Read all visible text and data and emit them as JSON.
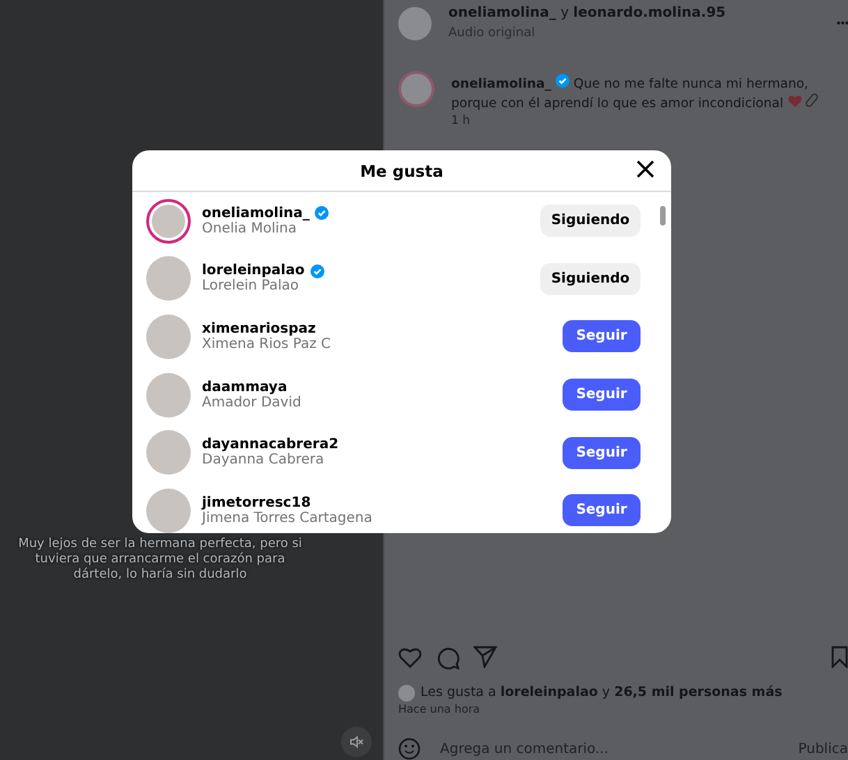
{
  "video": {
    "subtitle": "Muy lejos de ser la hermana perfecta, pero si tuviera que arrancarme el corazón para dártelo, lo haría sin dudarlo",
    "muted": true
  },
  "post": {
    "authors": "**oneliamolina_** y **leonardo.molina.95**",
    "audio": "Audio original",
    "caption": {
      "user": "oneliamolina_",
      "verified": true,
      "text": "Que no me falte nunca mi hermano, porque con él aprendí lo que es amor incondicional",
      "time": "1 h"
    },
    "likes": "Les gusta a **loreleinpalao** y **26,5 mil personas más**",
    "posted": "Hace una hora",
    "comment": {
      "placeholder": "Agrega un comentario...",
      "submit": "Publica"
    }
  },
  "likes_dialog": {
    "title": "Me gusta",
    "users": [
      {
        "username": "oneliamolina_",
        "name": "Onelia Molina",
        "verified": true,
        "story": true,
        "following": true,
        "button": "Siguiendo"
      },
      {
        "username": "loreleinpalao",
        "name": "Lorelein Palao",
        "verified": true,
        "story": false,
        "following": true,
        "button": "Siguiendo"
      },
      {
        "username": "ximenariospaz",
        "name": "Ximena Rios Paz C",
        "verified": false,
        "story": false,
        "following": false,
        "button": "Seguir"
      },
      {
        "username": "daammaya",
        "name": "Amador David",
        "verified": false,
        "story": false,
        "following": false,
        "button": "Seguir"
      },
      {
        "username": "dayannacabrera2",
        "name": "Dayanna Cabrera",
        "verified": false,
        "story": false,
        "following": false,
        "button": "Seguir"
      },
      {
        "username": "jimetorresc18",
        "name": "Jimena Torres Cartagena",
        "verified": false,
        "story": false,
        "following": false,
        "button": "Seguir"
      }
    ]
  }
}
